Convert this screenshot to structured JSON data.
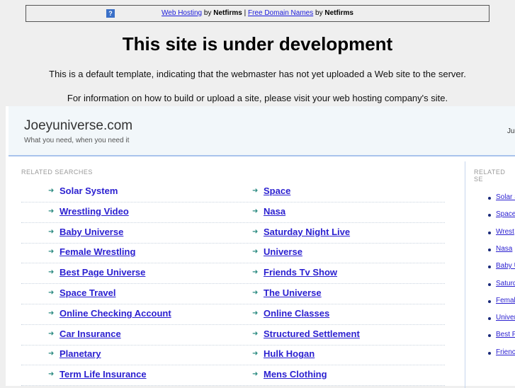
{
  "banner": {
    "link1": "Web Hosting",
    "by1": " by ",
    "brand1": "Netfirms",
    "sep": " | ",
    "link2": "Free Domain Names",
    "by2": " by ",
    "brand2": "Netfirms"
  },
  "heading": "This site is under development",
  "line1": "This is a default template, indicating that the webmaster has not yet uploaded a Web site to the server.",
  "line2": "For information on how to build or upload a site, please visit your web hosting company's site.",
  "site": {
    "name": "Joeyuniverse.com",
    "tagline": "What you need, when you need it",
    "right_text": "Ju"
  },
  "related_label": "RELATED SEARCHES",
  "related_label_right": "RELATED SE",
  "col1": [
    "Solar System",
    "Wrestling Video",
    "Baby Universe",
    "Female Wrestling",
    "Best Page Universe",
    "Space Travel",
    "Online Checking Account",
    "Car Insurance",
    "Planetary",
    "Term Life Insurance"
  ],
  "col2": [
    "Space",
    "Nasa",
    "Saturday Night Live",
    "Universe",
    "Friends Tv Show",
    "The Universe",
    "Online Classes",
    "Structured Settlement",
    "Hulk Hogan",
    "Mens Clothing"
  ],
  "right_list": [
    "Solar S",
    "Space",
    "Wrest",
    "Nasa",
    "Baby U",
    "Saturd",
    "Femal",
    "Univer",
    "Best P",
    "Frienc"
  ]
}
